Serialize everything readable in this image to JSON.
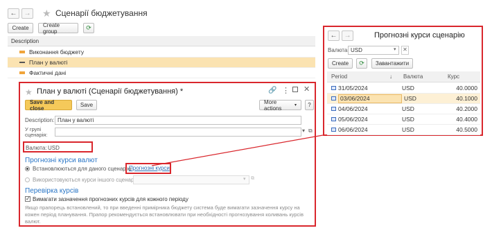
{
  "main": {
    "title": "Сценарії бюджетування",
    "create": "Create",
    "create_group": "Create group",
    "col_description": "Description",
    "items": [
      {
        "label": "Виконання бюджету"
      },
      {
        "label": "План у валюті"
      },
      {
        "label": "Фактичні дані"
      }
    ]
  },
  "dialog": {
    "title": "План у валюті (Сценарії бюджетування) *",
    "save_close": "Save and close",
    "save": "Save",
    "more_actions": "More actions",
    "description_label": "Description:",
    "description_value": "План у валюті",
    "group_label": "У групі сценарія:",
    "currency_label": "Валюта:",
    "currency_value": "USD",
    "rates_section": "Прогнозні курси валют",
    "radio1": "Встановлюються для даного сценарію",
    "rates_link": "Прогнозні курси",
    "radio2": "Використовуються курси іншого сценарію:",
    "check_section": "Перевірка курсів",
    "check_label": "Вимагати зазначення прогнозних курсів для кожного періоду",
    "hint": "Якщо прапорець встановлений, то при введенні примірника бюджету система буде вимагати зазначення курсу на кожен період планування. Прапор рекомендується встановлювати при необхідності прогнозування коливань курсів валют."
  },
  "rates": {
    "title": "Прогнозні курси сценарію",
    "currency_label": "Валюта:",
    "currency_value": "USD",
    "create": "Create",
    "load": "Завантажити",
    "headers": {
      "period": "Period",
      "currency": "Валюта",
      "rate": "Курс"
    },
    "rows": [
      {
        "period": "31/05/2024",
        "currency": "USD",
        "rate": "40.0000"
      },
      {
        "period": "03/06/2024",
        "currency": "USD",
        "rate": "40.1000"
      },
      {
        "period": "04/06/2024",
        "currency": "USD",
        "rate": "40.2000"
      },
      {
        "period": "05/06/2024",
        "currency": "USD",
        "rate": "40.4000"
      },
      {
        "period": "06/06/2024",
        "currency": "USD",
        "rate": "40.5000"
      }
    ]
  },
  "colors": {
    "accent": "#d9262c",
    "selected": "#fbe3b1",
    "primary_btn": "#f5c95a"
  }
}
